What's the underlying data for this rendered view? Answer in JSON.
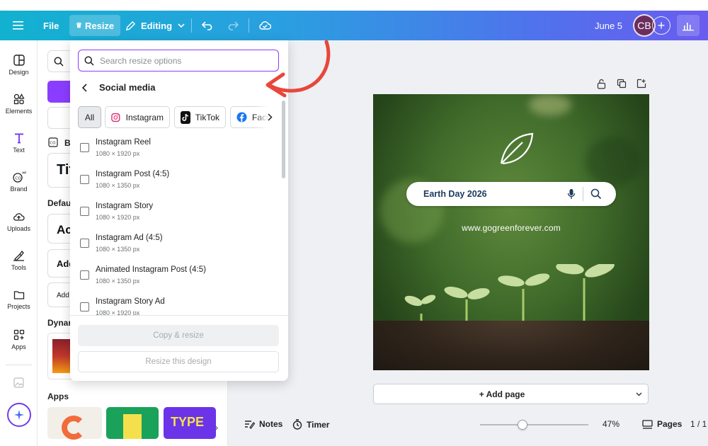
{
  "topbar": {
    "file_label": "File",
    "resize_label": "Resize",
    "editing_label": "Editing",
    "date_label": "June 5",
    "avatar_initials": "CB"
  },
  "rail": {
    "items": [
      {
        "label": "Design",
        "icon": "design-icon"
      },
      {
        "label": "Elements",
        "icon": "elements-icon"
      },
      {
        "label": "Text",
        "icon": "text-icon"
      },
      {
        "label": "Brand",
        "icon": "brand-icon"
      },
      {
        "label": "Uploads",
        "icon": "uploads-icon"
      },
      {
        "label": "Tools",
        "icon": "tools-icon"
      },
      {
        "label": "Projects",
        "icon": "projects-icon"
      },
      {
        "label": "Apps",
        "icon": "apps-icon"
      }
    ]
  },
  "sidepanel": {
    "brand_partial": "B",
    "title_partial": "Tit",
    "default_partial": "Defau",
    "ac_partial": "Ac",
    "add1_partial": "Add",
    "add2_partial": "Add",
    "dynamic_partial": "Dynar",
    "apps_label": "Apps"
  },
  "resize_dropdown": {
    "search_placeholder": "Search resize options",
    "section_title": "Social media",
    "chips": [
      "All",
      "Instagram",
      "TikTok",
      "Face"
    ],
    "options": [
      {
        "name": "Instagram Reel",
        "size": "1080 × 1920 px"
      },
      {
        "name": "Instagram Post (4:5)",
        "size": "1080 × 1350 px"
      },
      {
        "name": "Instagram Story",
        "size": "1080 × 1920 px"
      },
      {
        "name": "Instagram Ad (4:5)",
        "size": "1080 × 1350 px"
      },
      {
        "name": "Animated Instagram Post (4:5)",
        "size": "1080 × 1350 px"
      },
      {
        "name": "Instagram Story Ad",
        "size": "1080 × 1920 px"
      }
    ],
    "copy_resize_label": "Copy & resize",
    "resize_design_label": "Resize this design"
  },
  "design": {
    "search_text": "Earth Day 2026",
    "url_text": "www.gogreenforever.com"
  },
  "canvas": {
    "add_page_label": "+ Add page"
  },
  "bottombar": {
    "notes_label": "Notes",
    "timer_label": "Timer",
    "zoom_label": "47%",
    "zoom_value": 47,
    "pages_label": "Pages",
    "page_count": "1 / 1"
  },
  "colors": {
    "accent": "#8b3dff",
    "annotation": "#e8473a",
    "pill_text": "#1e3a5c"
  }
}
